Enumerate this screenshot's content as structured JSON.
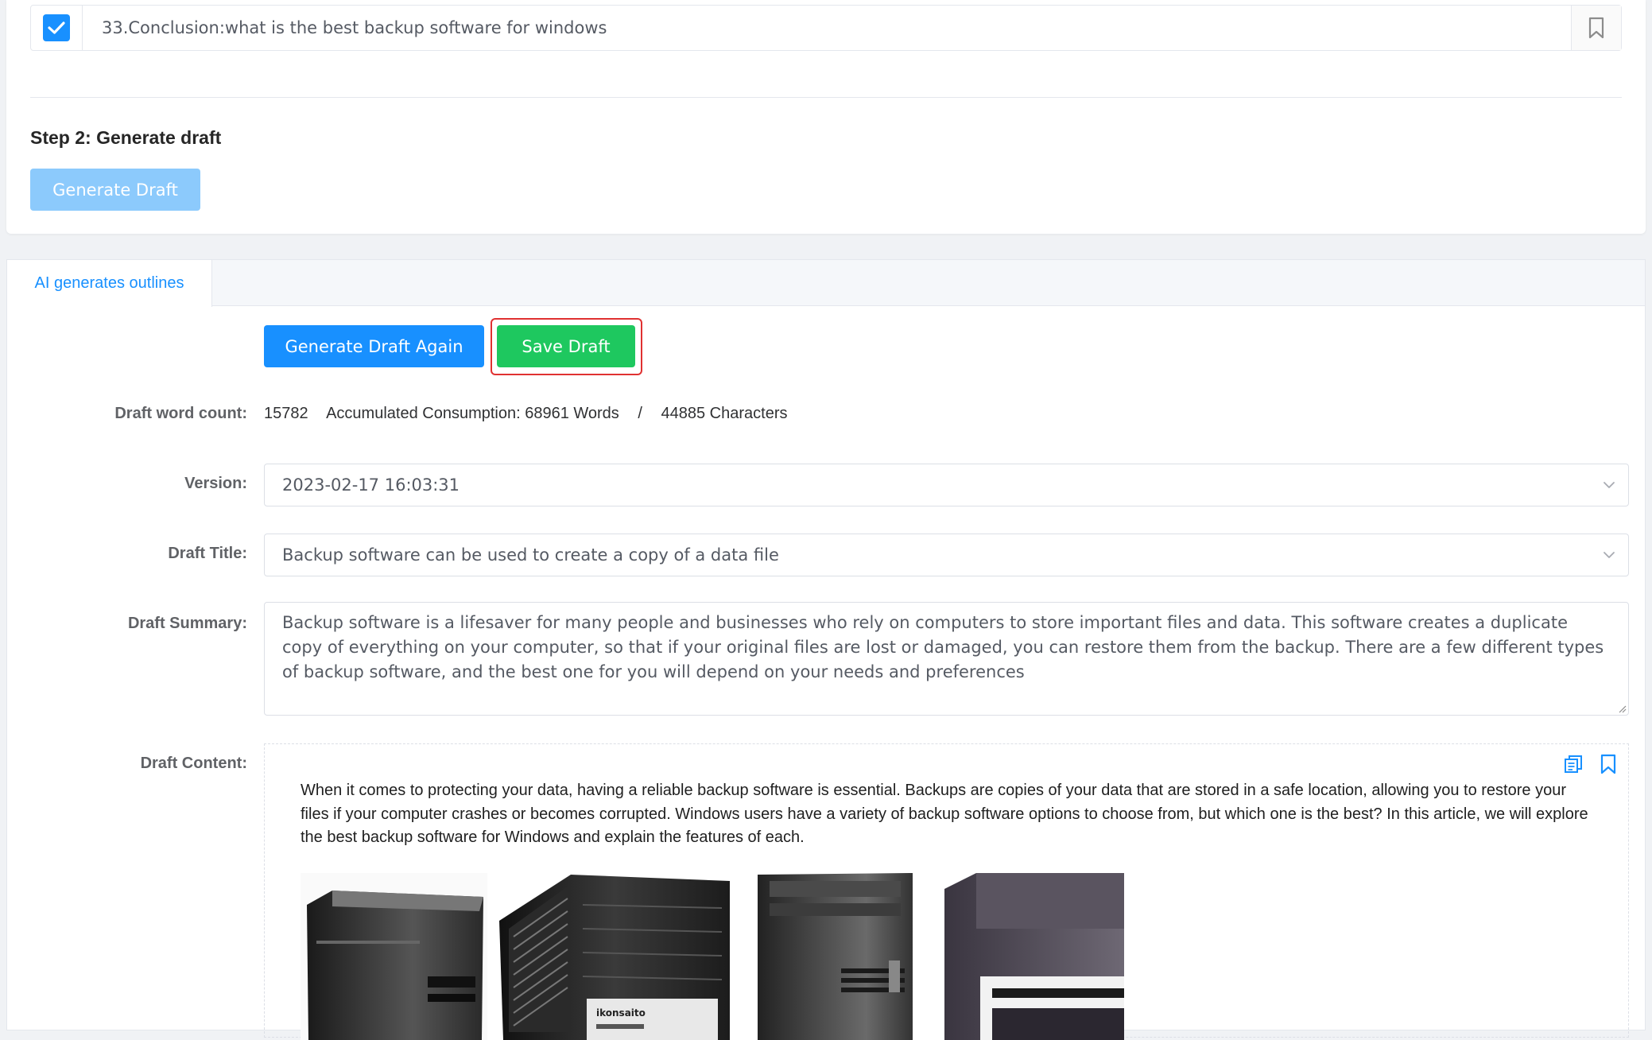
{
  "outline_item": {
    "text": "33.Conclusion:what is the best backup software for windows",
    "checked": true
  },
  "step2": {
    "title": "Step 2: Generate draft",
    "button_label": "Generate Draft"
  },
  "tabs": [
    {
      "label": "AI generates outlines",
      "active": true
    }
  ],
  "actions": {
    "generate_again_label": "Generate Draft Again",
    "save_label": "Save Draft"
  },
  "labels": {
    "word_count": "Draft word count:",
    "version": "Version:",
    "title": "Draft Title:",
    "summary": "Draft Summary:",
    "content": "Draft Content:"
  },
  "stats": {
    "word_count": "15782",
    "consumption": "Accumulated Consumption: 68961 Words",
    "separator": "/",
    "characters": "44885 Characters"
  },
  "version": {
    "selected": "2023-02-17 16:03:31"
  },
  "draft_title": {
    "selected": "Backup software can be used to create a copy of a data file"
  },
  "draft_summary": {
    "value": "Backup software is a lifesaver for many people and businesses who rely on computers to store important files and data. This software creates a duplicate copy of everything on your computer, so that if your original files are lost or damaged, you can restore them from the backup. There are a few different types of backup software, and the best one for you will depend on your needs and preferences"
  },
  "draft_content": {
    "paragraph": "When it comes to protecting your data, having a reliable backup software is essential. Backups are copies of your data that are stored in a safe location, allowing you to restore your files if your computer crashes or becomes corrupted. Windows users have a variety of backup software options to choose from, but which one is the best? In this article, we will explore the best backup software for Windows and explain the features of each.",
    "image_caption_text": "ikonsaito"
  },
  "colors": {
    "primary": "#1890ff",
    "primary_disabled": "#8ccafc",
    "success": "#1ec85f",
    "highlight": "#e03131"
  },
  "icons": {
    "checkbox": "check-icon",
    "bookmark": "bookmark-icon",
    "chevron": "chevron-down-icon",
    "copy": "copy-icon"
  }
}
